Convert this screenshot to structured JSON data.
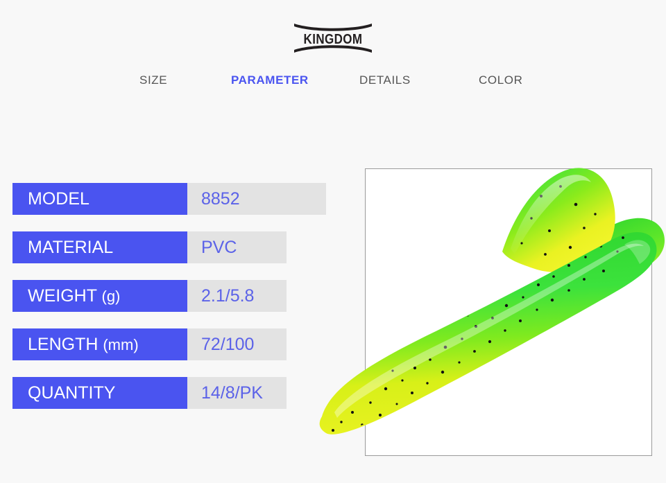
{
  "brand": {
    "name": "KINGDOM",
    "logo_icon": "kingdom-wordmark-logo"
  },
  "tabs": [
    {
      "id": "size",
      "label": "SIZE",
      "active": false
    },
    {
      "id": "parameter",
      "label": "PARAMETER",
      "active": true
    },
    {
      "id": "details",
      "label": "DETAILS",
      "active": false
    },
    {
      "id": "color",
      "label": "COLOR",
      "active": false
    }
  ],
  "spec_table": {
    "rows": [
      {
        "label": "MODEL",
        "unit": "",
        "value": "8852"
      },
      {
        "label": "MATERIAL",
        "unit": "",
        "value": "PVC"
      },
      {
        "label": "WEIGHT",
        "unit": "(g)",
        "value": "2.1/5.8"
      },
      {
        "label": "LENGTH",
        "unit": "(mm)",
        "value": "72/100"
      },
      {
        "label": "QUANTITY",
        "unit": "",
        "value": "14/8/PK"
      }
    ]
  },
  "product_image": {
    "alt": "soft plastic paddle tail shad fishing lure",
    "icon": "fishing-lure-image",
    "body_top_color": "#3ce23c",
    "body_bottom_color": "#e8f215",
    "glitter_color": "#1a1a1a"
  },
  "colors": {
    "accent_blue": "#4a54f0",
    "value_blue": "#5b62e8",
    "value_cell_bg": "#e3e3e3",
    "page_bg": "#f8f8f8",
    "tab_inactive": "#555555",
    "panel_border": "#9a9a9a"
  }
}
